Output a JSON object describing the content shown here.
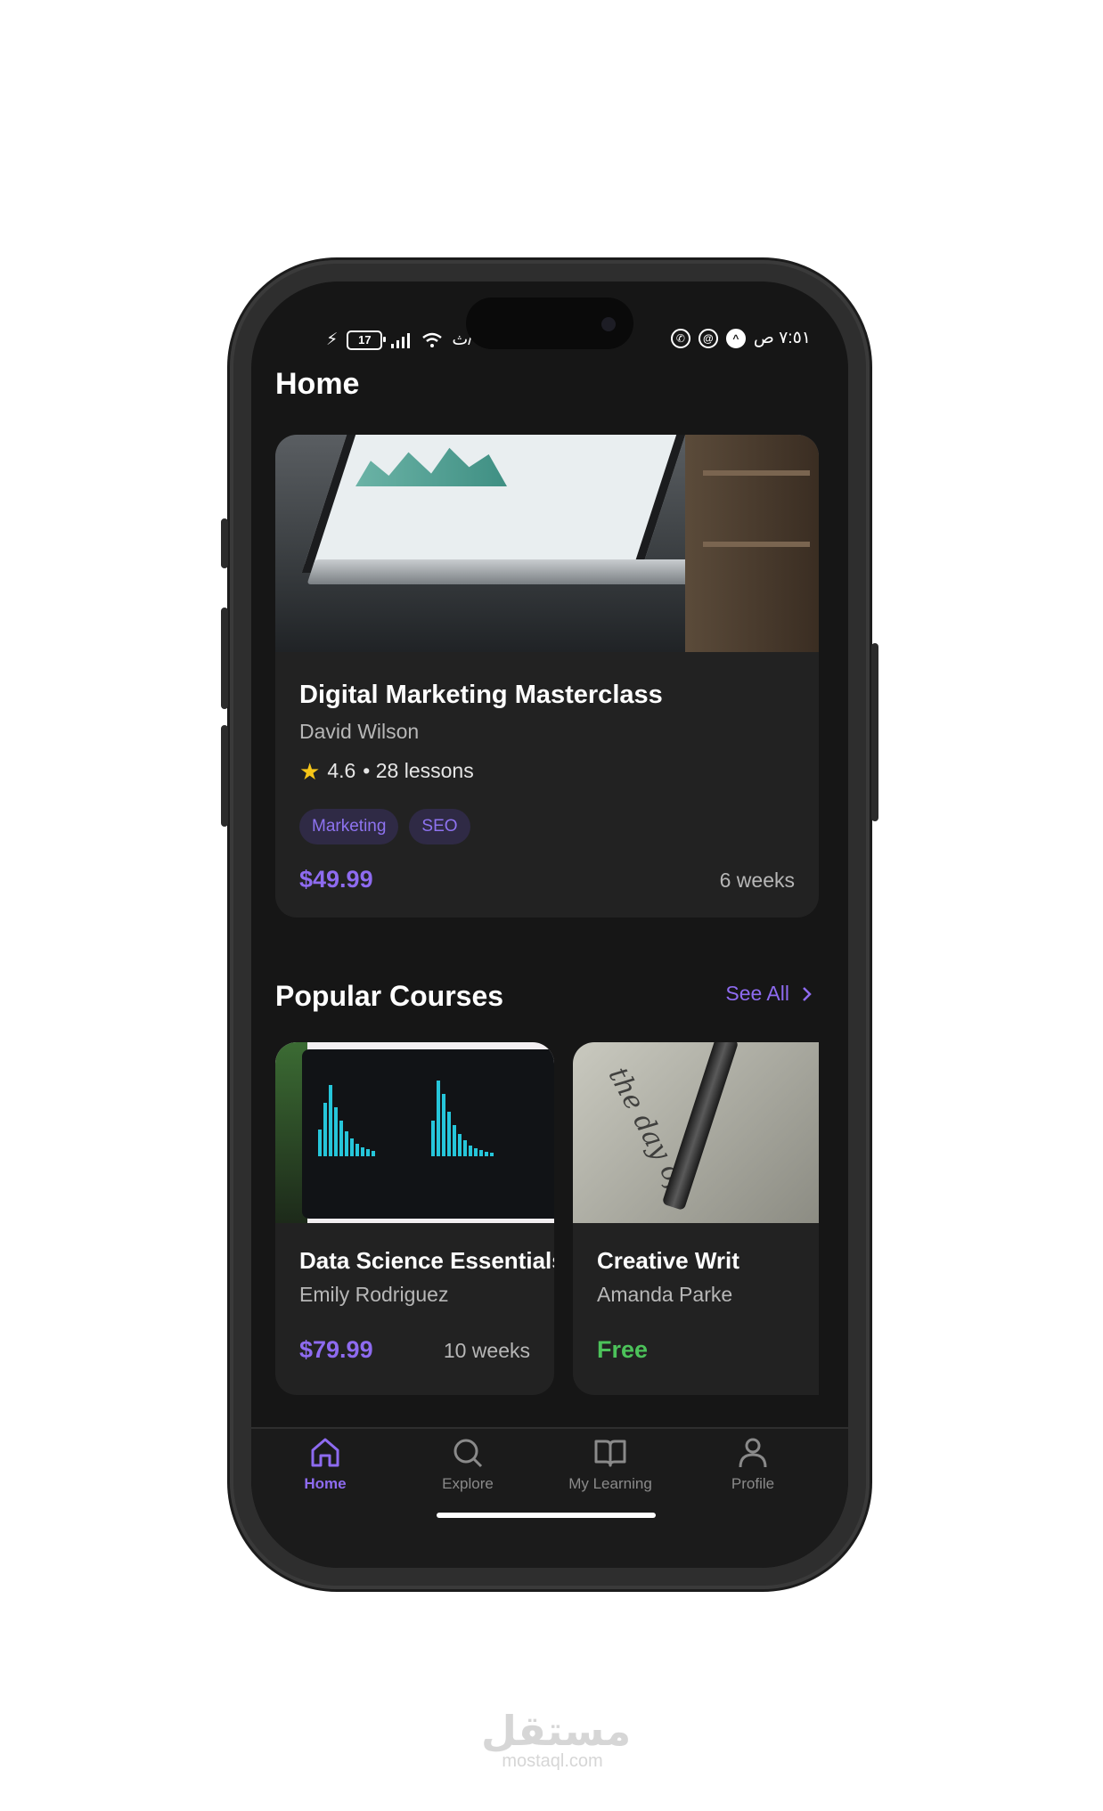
{
  "status_bar": {
    "left_text": "ث/",
    "battery": "17",
    "time": "٧:٥١ ص"
  },
  "header": {
    "title": "Home"
  },
  "featured": {
    "title": "Digital Marketing Masterclass",
    "author": "David Wilson",
    "rating": "4.6",
    "lessons": "• 28 lessons",
    "tags": [
      "Marketing",
      "SEO"
    ],
    "price": "$49.99",
    "duration": "6 weeks"
  },
  "popular": {
    "title": "Popular Courses",
    "see_all": "See All",
    "courses": [
      {
        "title": "Data Science Essentials",
        "author": "Emily Rodriguez",
        "price": "$79.99",
        "duration": "10 weeks"
      },
      {
        "title": "Creative Writ",
        "author": "Amanda Parke",
        "price": "Free"
      }
    ]
  },
  "nav": {
    "items": [
      {
        "label": "Home",
        "icon": "home-icon",
        "active": true
      },
      {
        "label": "Explore",
        "icon": "search-icon"
      },
      {
        "label": "My Learning",
        "icon": "book-icon"
      },
      {
        "label": "Profile",
        "icon": "user-icon"
      }
    ]
  },
  "watermark": {
    "arabic": "مستقل",
    "latin": "mostaql.com"
  },
  "colors": {
    "accent": "#8e6bf0",
    "free": "#4cc25a",
    "background": "#161616",
    "card": "#222222"
  }
}
